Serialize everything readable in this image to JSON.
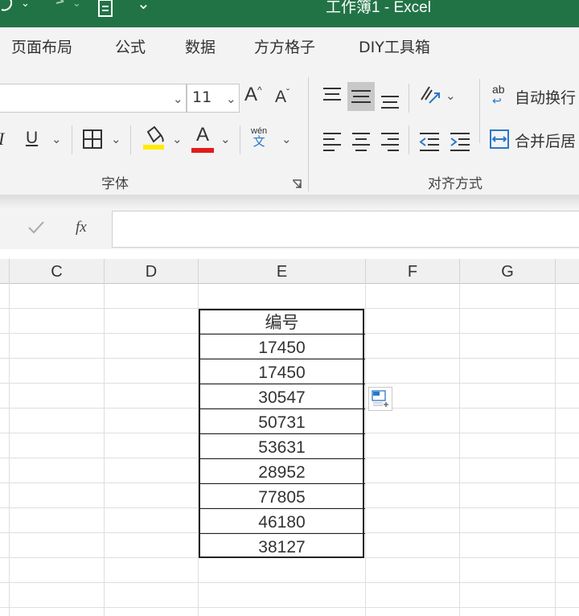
{
  "titlebar": {
    "title": "工作簿1  -  Excel",
    "quick_access": [
      "undo-icon",
      "redo-icon",
      "print-preview-icon",
      "customize-icon"
    ]
  },
  "menu": {
    "items": [
      "页面布局",
      "公式",
      "数据",
      "方方格子",
      "DIY工具箱"
    ]
  },
  "ribbon": {
    "font_size": "11",
    "grow_font": "A",
    "shrink_font": "A",
    "italic": "I",
    "underline": "U",
    "font_color": "A",
    "phonetic_top": "wén",
    "phonetic_bottom": "文",
    "wrap_text_glyph": "ab",
    "wrap_text": "自动换行",
    "merge_center": "合并后居",
    "font_group": "字体",
    "align_group": "对齐方式",
    "fill_color": "#ffeb00",
    "text_color": "#e21b1b"
  },
  "formula_bar": {
    "fx_label": "fx",
    "value": ""
  },
  "columns": [
    "C",
    "D",
    "E",
    "F",
    "G"
  ],
  "table": {
    "header": "编号",
    "rows": [
      "17450",
      "17450",
      "30547",
      "50731",
      "53631",
      "28952",
      "77805",
      "46180",
      "38127"
    ]
  },
  "colors": {
    "accent": "#217346"
  }
}
